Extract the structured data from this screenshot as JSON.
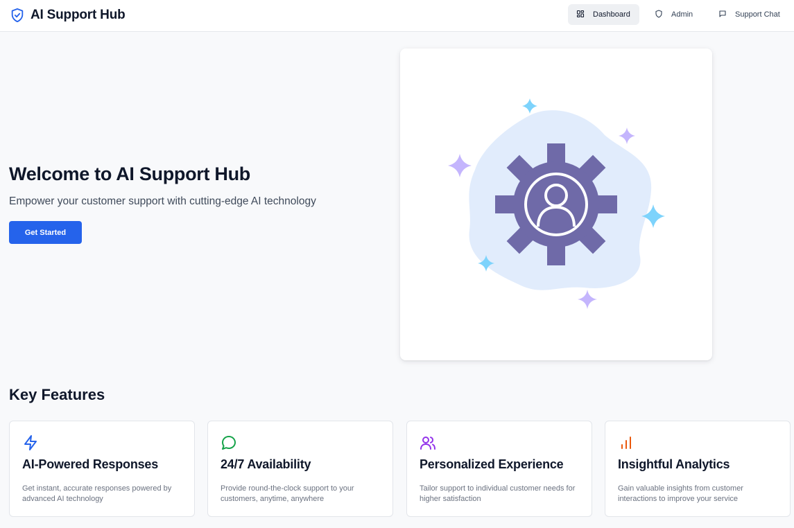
{
  "app": {
    "title": "AI Support Hub"
  },
  "nav": {
    "items": [
      {
        "label": "Dashboard",
        "icon": "dashboard-icon",
        "active": true
      },
      {
        "label": "Admin",
        "icon": "shield-icon",
        "active": false
      },
      {
        "label": "Support Chat",
        "icon": "chat-icon",
        "active": false
      }
    ]
  },
  "hero": {
    "title": "Welcome to AI Support Hub",
    "subtitle": "Empower your customer support with cutting-edge AI technology",
    "cta_label": "Get Started",
    "illustration": "gear-user-icon"
  },
  "features": {
    "heading": "Key Features",
    "items": [
      {
        "title": "AI-Powered Responses",
        "description": "Get instant, accurate responses powered by advanced AI technology",
        "icon": "lightning-icon",
        "color": "#2563eb"
      },
      {
        "title": "24/7 Availability",
        "description": "Provide round-the-clock support to your customers, anytime, anywhere",
        "icon": "message-circle-icon",
        "color": "#16a34a"
      },
      {
        "title": "Personalized Experience",
        "description": "Tailor support to individual customer needs for higher satisfaction",
        "icon": "users-icon",
        "color": "#9333ea"
      },
      {
        "title": "Insightful Analytics",
        "description": "Gain valuable insights from customer interactions to improve your service",
        "icon": "bar-chart-icon",
        "color": "#ea580c"
      }
    ]
  },
  "colors": {
    "brand": "#2563eb",
    "background": "#f8f9fb",
    "gear": "#6f6aa8",
    "blob": "#e1ecfc"
  }
}
